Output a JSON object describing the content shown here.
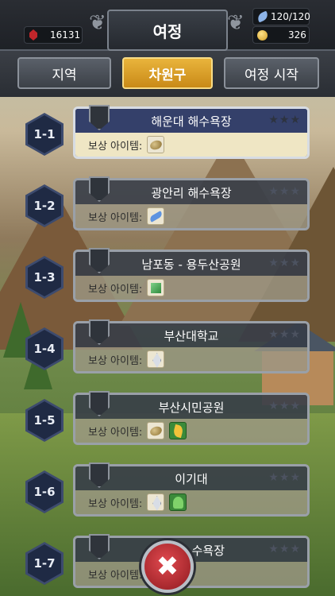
{
  "header": {
    "title": "여정",
    "gems": "16131",
    "stamina": "120/120",
    "gold": "326"
  },
  "tabs": [
    {
      "label": "지역"
    },
    {
      "label": "차원구"
    },
    {
      "label": "여정 시작"
    }
  ],
  "reward_label": "보상 아이템:",
  "stages": [
    {
      "num": "1-1",
      "name": "해운대 해수욕장",
      "stars": "★★★"
    },
    {
      "num": "1-2",
      "name": "광안리 해수욕장",
      "stars": "★★★"
    },
    {
      "num": "1-3",
      "name": "남포동 - 용두산공원",
      "stars": "★★★"
    },
    {
      "num": "1-4",
      "name": "부산대학교",
      "stars": "★★★"
    },
    {
      "num": "1-5",
      "name": "부산시민공원",
      "stars": "★★★"
    },
    {
      "num": "1-6",
      "name": "이기대",
      "stars": "★★★"
    },
    {
      "num": "1-7",
      "name": "수욕장",
      "stars": "★★★"
    }
  ],
  "close_symbol": "✖",
  "icons": {
    "gems": "red-gem-icon",
    "stamina": "feather-icon",
    "gold": "gold-coin-icon",
    "close": "close-icon"
  },
  "colors": {
    "active_tab": "#e9b43c",
    "active_card_header": "#34406a",
    "close_button": "#c8323a"
  }
}
